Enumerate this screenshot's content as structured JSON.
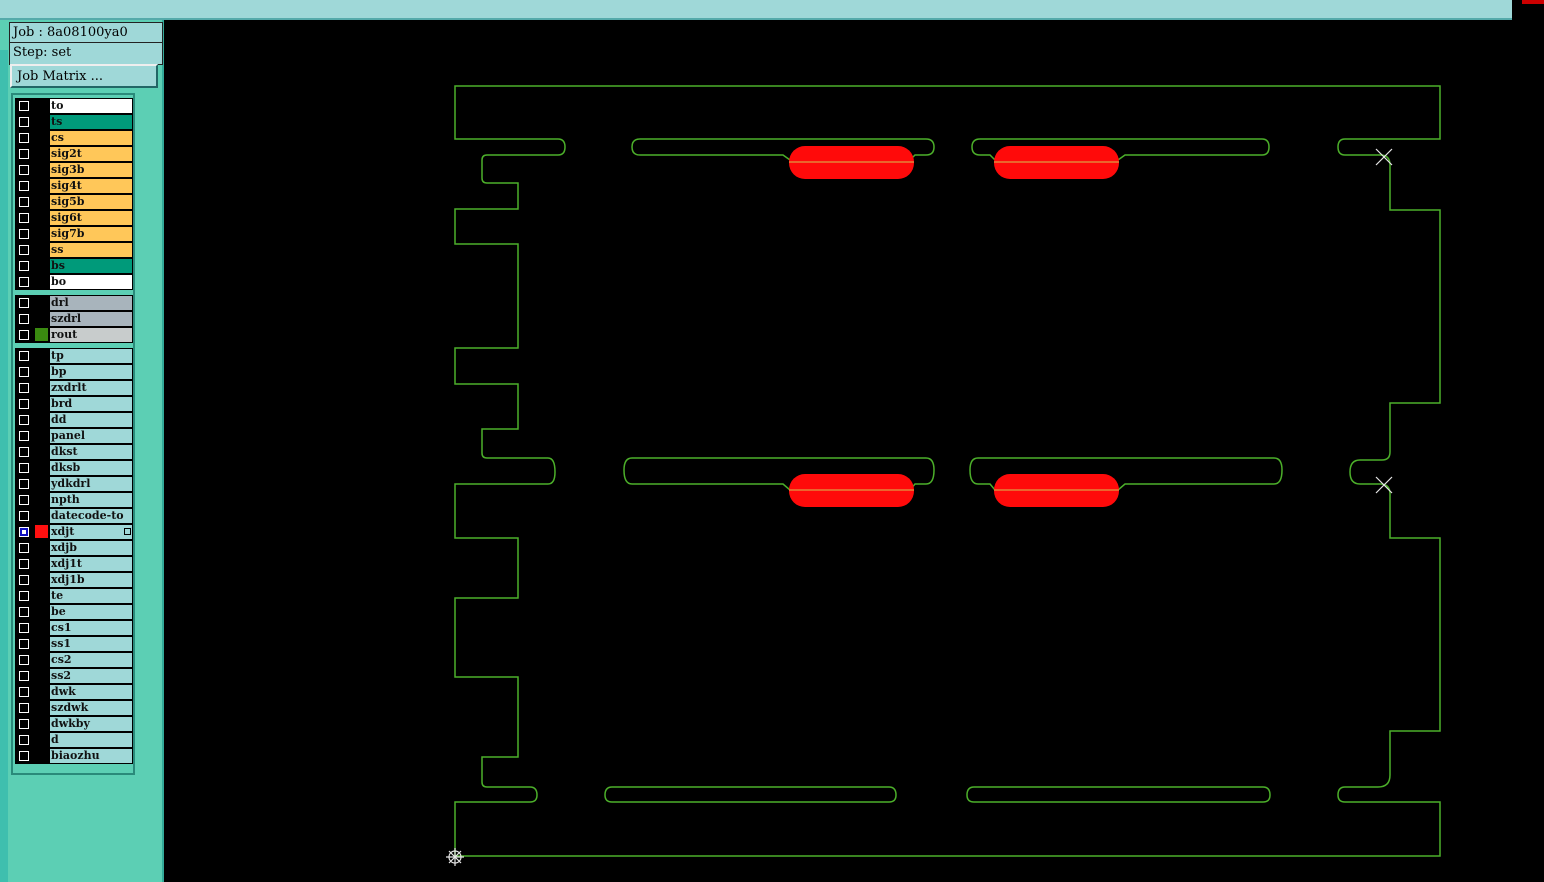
{
  "job_label": "Job : 8a08100ya0",
  "step_label": "Step: set",
  "job_matrix_button": "Job Matrix ...",
  "colors": {
    "board_layer": "#ffc759",
    "solder_mask": "#009a7a",
    "white_layer": "#ffffff",
    "drill_layer": "#a8b4bc",
    "rout_layer": "#c8cccc",
    "misc_layer": "#9fd8d8",
    "rout_swatch": "#3a8a10",
    "xdjt_swatch": "#ff1010",
    "outline": "#4caf2a",
    "feature_fill": "#ff0a0a"
  },
  "layer_groups": [
    {
      "layers": [
        {
          "name": "to",
          "color": "white"
        },
        {
          "name": "ts",
          "color": "mask"
        },
        {
          "name": "cs",
          "color": "board"
        },
        {
          "name": "sig2t",
          "color": "board"
        },
        {
          "name": "sig3b",
          "color": "board"
        },
        {
          "name": "sig4t",
          "color": "board"
        },
        {
          "name": "sig5b",
          "color": "board"
        },
        {
          "name": "sig6t",
          "color": "board"
        },
        {
          "name": "sig7b",
          "color": "board"
        },
        {
          "name": "ss",
          "color": "board"
        },
        {
          "name": "bs",
          "color": "mask"
        },
        {
          "name": "bo",
          "color": "white"
        }
      ]
    },
    {
      "layers": [
        {
          "name": "drl",
          "color": "drill"
        },
        {
          "name": "szdrl",
          "color": "drill"
        },
        {
          "name": "rout",
          "color": "rout",
          "swatch": "rout"
        }
      ]
    },
    {
      "layers": [
        {
          "name": "tp",
          "color": "misc"
        },
        {
          "name": "bp",
          "color": "misc"
        },
        {
          "name": "zxdrlt",
          "color": "misc"
        },
        {
          "name": "brd",
          "color": "misc"
        },
        {
          "name": "dd",
          "color": "misc"
        },
        {
          "name": "panel",
          "color": "misc"
        },
        {
          "name": "dkst",
          "color": "misc"
        },
        {
          "name": "dksb",
          "color": "misc"
        },
        {
          "name": "ydkdrl",
          "color": "misc"
        },
        {
          "name": "npth",
          "color": "misc"
        },
        {
          "name": "datecode-to",
          "color": "misc"
        },
        {
          "name": "xdjt",
          "color": "misc",
          "swatch": "xdjt",
          "active": true
        },
        {
          "name": "xdjb",
          "color": "misc"
        },
        {
          "name": "xdj1t",
          "color": "misc"
        },
        {
          "name": "xdj1b",
          "color": "misc"
        },
        {
          "name": "te",
          "color": "misc"
        },
        {
          "name": "be",
          "color": "misc"
        },
        {
          "name": "cs1",
          "color": "misc"
        },
        {
          "name": "ss1",
          "color": "misc"
        },
        {
          "name": "cs2",
          "color": "misc"
        },
        {
          "name": "ss2",
          "color": "misc"
        },
        {
          "name": "dwk",
          "color": "misc"
        },
        {
          "name": "szdwk",
          "color": "misc"
        },
        {
          "name": "dwkby",
          "color": "misc"
        },
        {
          "name": "d",
          "color": "misc"
        },
        {
          "name": "biaozhu",
          "color": "misc"
        }
      ]
    }
  ]
}
